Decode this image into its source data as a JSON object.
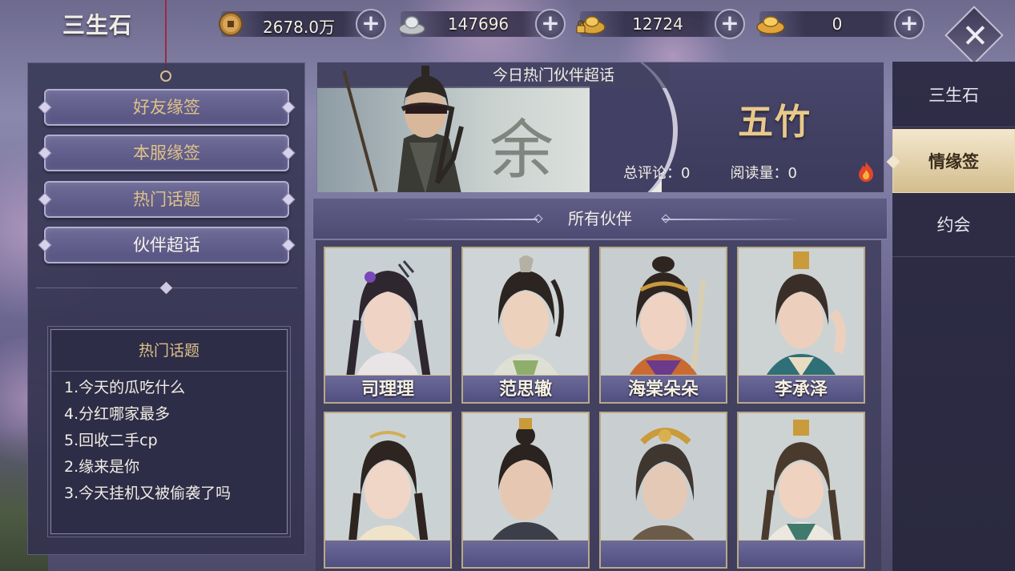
{
  "app": {
    "title": "三生石"
  },
  "currencies": [
    {
      "name": "copper-coin",
      "value": "2678.0万",
      "icon": "copper-coin-icon"
    },
    {
      "name": "silver-ingot",
      "value": "147696",
      "icon": "silver-ingot-icon"
    },
    {
      "name": "bound-gold-ingot",
      "value": "12724",
      "icon": "locked-gold-ingot-icon"
    },
    {
      "name": "gold-ingot",
      "value": "0",
      "icon": "gold-ingot-icon"
    }
  ],
  "plus_label": "+",
  "close_label": "✕",
  "left_nav": {
    "items": [
      {
        "label": "好友缘签",
        "style": "gold"
      },
      {
        "label": "本服缘签",
        "style": "gold"
      },
      {
        "label": "热门话题",
        "style": "gold"
      },
      {
        "label": "伙伴超话",
        "style": "white",
        "active": true
      }
    ]
  },
  "hot_topics": {
    "title": "热门话题",
    "items": [
      "1.今天的瓜吃什么",
      "4.分红哪家最多",
      "5.回收二手cp",
      "2.缘来是你",
      "3.今天挂机又被偷袭了吗"
    ]
  },
  "banner": {
    "headline": "今日热门伙伴超话",
    "hero_name": "五竹",
    "comments_label": "总评论：",
    "comments_value": "0",
    "reads_label": "阅读量：",
    "reads_value": "0"
  },
  "section": {
    "title": "所有伙伴"
  },
  "partners": [
    {
      "name": "司理理"
    },
    {
      "name": "范思辙"
    },
    {
      "name": "海棠朵朵"
    },
    {
      "name": "李承泽"
    },
    {
      "name": ""
    },
    {
      "name": ""
    },
    {
      "name": ""
    },
    {
      "name": ""
    }
  ],
  "right_tabs": [
    {
      "label": "三生石",
      "active": false
    },
    {
      "label": "情缘签",
      "active": true
    },
    {
      "label": "约会",
      "active": false
    }
  ],
  "colors": {
    "gold_text": "#dfc188",
    "hero_name": "#e9c98b",
    "active_tab_bg": "#e8d6ad",
    "panel_bg": "#3a3a58"
  }
}
